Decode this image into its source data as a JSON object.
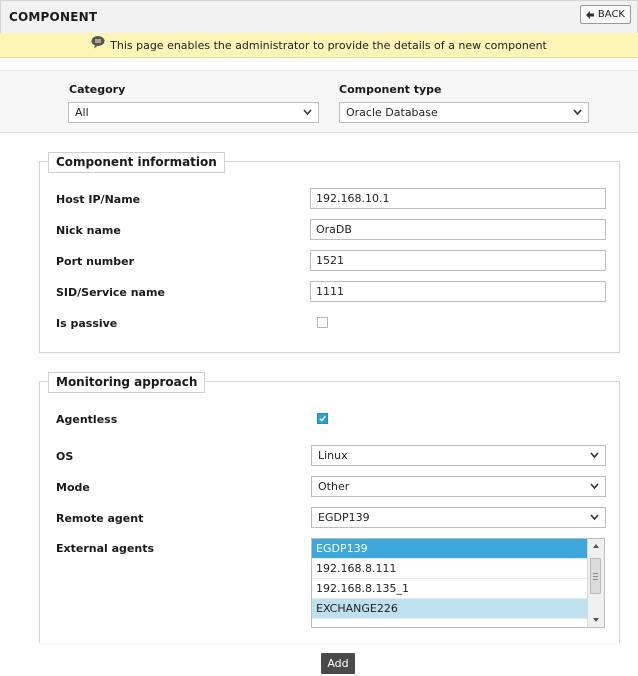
{
  "header": {
    "title": "COMPONENT",
    "back_label": "BACK"
  },
  "info": {
    "text": "This page enables the administrator to provide the details of a new component"
  },
  "filters": {
    "category_label": "Category",
    "category_value": "All",
    "component_type_label": "Component type",
    "component_type_value": "Oracle Database"
  },
  "component_info": {
    "legend": "Component information",
    "host_label": "Host IP/Name",
    "host_value": "192.168.10.1",
    "nick_label": "Nick name",
    "nick_value": "OraDB",
    "port_label": "Port number",
    "port_value": "1521",
    "sid_label": "SID/Service name",
    "sid_value": "1111",
    "passive_label": "Is passive",
    "passive_checked": false
  },
  "monitoring": {
    "legend": "Monitoring approach",
    "agentless_label": "Agentless",
    "agentless_checked": true,
    "os_label": "OS",
    "os_value": "Linux",
    "mode_label": "Mode",
    "mode_value": "Other",
    "remote_agent_label": "Remote agent",
    "remote_agent_value": "EGDP139",
    "external_agents_label": "External agents",
    "external_agents": [
      {
        "label": "EGDP139",
        "state": "selected"
      },
      {
        "label": "192.168.8.111",
        "state": "normal"
      },
      {
        "label": "192.168.8.135_1",
        "state": "normal"
      },
      {
        "label": "EXCHANGE226",
        "state": "selected-inactive"
      },
      {
        "label": "",
        "state": "normal"
      }
    ]
  },
  "actions": {
    "add_label": "Add"
  },
  "colors": {
    "info_bar": "#fdf5b5",
    "selection": "#3ea8dc",
    "selection_inactive": "#bfe0ee",
    "checkbox_checked": "#2aa3d8",
    "add_button": "#4a4a4a"
  },
  "icons": {
    "back": "back-arrow-icon",
    "info": "speech-bubble-icon",
    "dropdown": "chevron-down-icon",
    "check": "checkmark-icon"
  }
}
